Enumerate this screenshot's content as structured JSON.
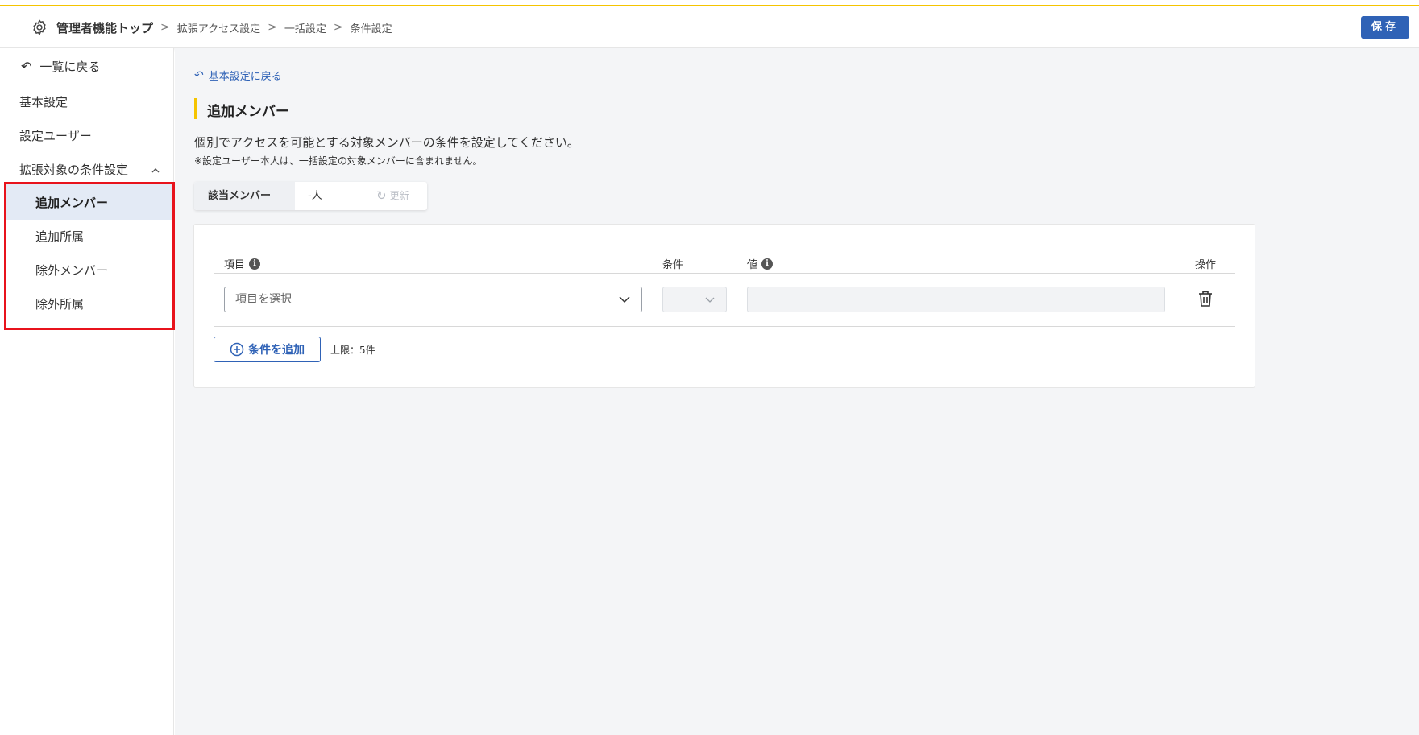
{
  "header": {
    "breadcrumb": {
      "top": "管理者機能トップ",
      "items": [
        "拡張アクセス設定",
        "一括設定",
        "条件設定"
      ],
      "separator": ">"
    },
    "save_label": "保存",
    "icons": {
      "settings": "gear-icon"
    }
  },
  "colors": {
    "accent_yellow": "#f5c400",
    "primary_blue": "#2f62b6",
    "highlight_red": "#e8131c",
    "active_bg": "#e3eaf5"
  },
  "sidebar": {
    "back_label": "一覧に戻る",
    "items": [
      {
        "label": "基本設定"
      },
      {
        "label": "設定ユーザー"
      },
      {
        "label": "拡張対象の条件設定",
        "expanded": true
      }
    ],
    "sub_items": [
      {
        "label": "追加メンバー",
        "active": true
      },
      {
        "label": "追加所属"
      },
      {
        "label": "除外メンバー"
      },
      {
        "label": "除外所属"
      }
    ]
  },
  "main": {
    "back_link": "基本設定に戻る",
    "section_title": "追加メンバー",
    "description": "個別でアクセスを可能とする対象メンバーの条件を設定してください。",
    "note": "※設定ユーザー本人は、一括設定の対象メンバーに含まれません。",
    "member_count": {
      "label": "該当メンバー",
      "value": "-人",
      "refresh_label": "更新"
    },
    "conditions": {
      "columns": [
        "項目",
        "条件",
        "値",
        "操作"
      ],
      "rows": [
        {
          "item_placeholder": "項目を選択",
          "condition": "",
          "value": ""
        }
      ],
      "add_label": "条件を追加",
      "limit_text": "上限：5件"
    }
  }
}
